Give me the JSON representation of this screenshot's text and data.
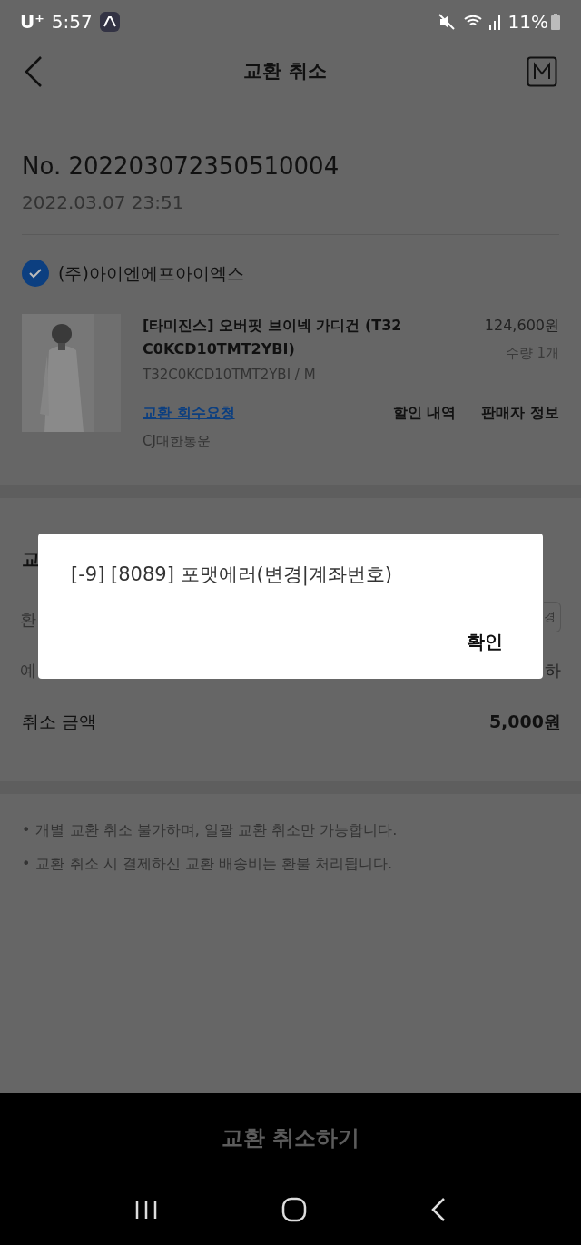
{
  "status_bar": {
    "carrier": "U⁺",
    "time": "5:57",
    "battery": "11%"
  },
  "header": {
    "title": "교환 취소"
  },
  "order": {
    "number": "No. 202203072350510004",
    "date": "2022.03.07 23:51"
  },
  "seller": {
    "name": "(주)아이엔에프아이엑스",
    "checked": true
  },
  "product": {
    "kind": "picture",
    "name": "[타미진스] 오버핏 브이넥 가디건 (T32 C0KCD10TMT2YBI)",
    "option": "T32C0KCD10TMT2YBI / M",
    "price": "124,600원",
    "quantity": "수량 1개",
    "link": "교환 회수요청",
    "courier": "CJ대한통운",
    "actions": [
      "할인 내역",
      "판매자 정보"
    ]
  },
  "refund_section": {
    "title_fragment": "교",
    "rows": [
      {
        "label_fragment": "환",
        "value_fragment": "경"
      },
      {
        "label_fragment": "예",
        "value_fragment": "하"
      }
    ],
    "total_label": "취소 금액",
    "total_value": "5,000원"
  },
  "notes": [
    {
      "bullet": "•",
      "text": "개별 교환 취소 불가하며, 일괄 교환 취소만 가능합니다."
    },
    {
      "bullet": "•",
      "text": "교환 취소 시 결제하신 교환 배송비는 환불 처리됩니다."
    }
  ],
  "submit_button": "교환 취소하기",
  "dialog": {
    "message": "[-9] [8089] 포맷에러(변경|계좌번호)",
    "confirm": "확인"
  }
}
